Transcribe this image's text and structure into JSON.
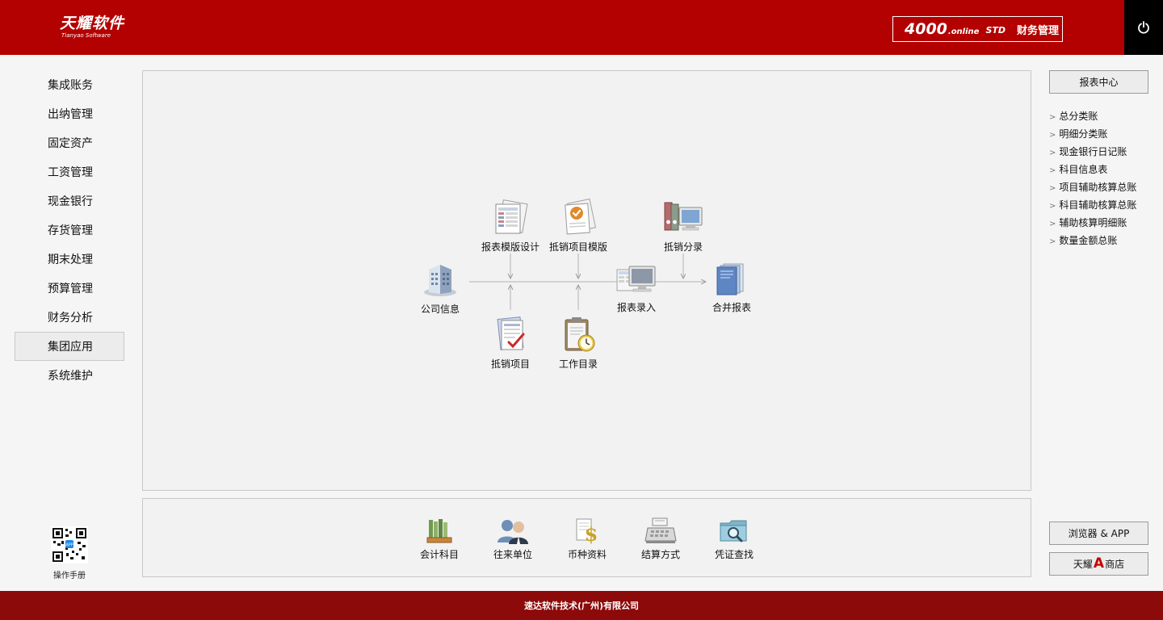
{
  "header": {
    "logo_cn": "天耀软件",
    "logo_en": "Tianyao Software",
    "product_num": "4000",
    "product_online": ".online",
    "product_std": "STD",
    "product_title": "财务管理"
  },
  "sidebar": {
    "items": [
      {
        "label": "集成账务"
      },
      {
        "label": "出纳管理"
      },
      {
        "label": "固定资产"
      },
      {
        "label": "工资管理"
      },
      {
        "label": "现金银行"
      },
      {
        "label": "存货管理"
      },
      {
        "label": "期末处理"
      },
      {
        "label": "预算管理"
      },
      {
        "label": "财务分析"
      },
      {
        "label": "集团应用"
      },
      {
        "label": "系统维护"
      }
    ],
    "active_index": 9,
    "manual_label": "操作手册"
  },
  "flow": {
    "company_info": "公司信息",
    "report_template_design": "报表模版设计",
    "offset_item_template": "抵销项目模版",
    "offset_item": "抵销项目",
    "work_directory": "工作目录",
    "report_entry": "报表录入",
    "offset_entry": "抵销分录",
    "consolidated_report": "合并报表"
  },
  "toolbar": {
    "accounting_subjects": "会计科目",
    "business_units": "往来单位",
    "currency_data": "币种资料",
    "settlement_method": "结算方式",
    "voucher_search": "凭证查找"
  },
  "right": {
    "report_center": "报表中心",
    "reports": [
      "总分类账",
      "明细分类账",
      "现金银行日记账",
      "科目信息表",
      "项目辅助核算总账",
      "科目辅助核算总账",
      "辅助核算明细账",
      "数量金额总账"
    ],
    "browser_app": "浏览器 & APP",
    "store_prefix": "天耀",
    "store_letter": "A",
    "store_suffix": "商店"
  },
  "footer": {
    "company": "速达软件技术(广州)有限公司"
  },
  "colors": {
    "header_red": "#b30000",
    "footer_red": "#8c0a0a",
    "power_bg": "#000000"
  }
}
